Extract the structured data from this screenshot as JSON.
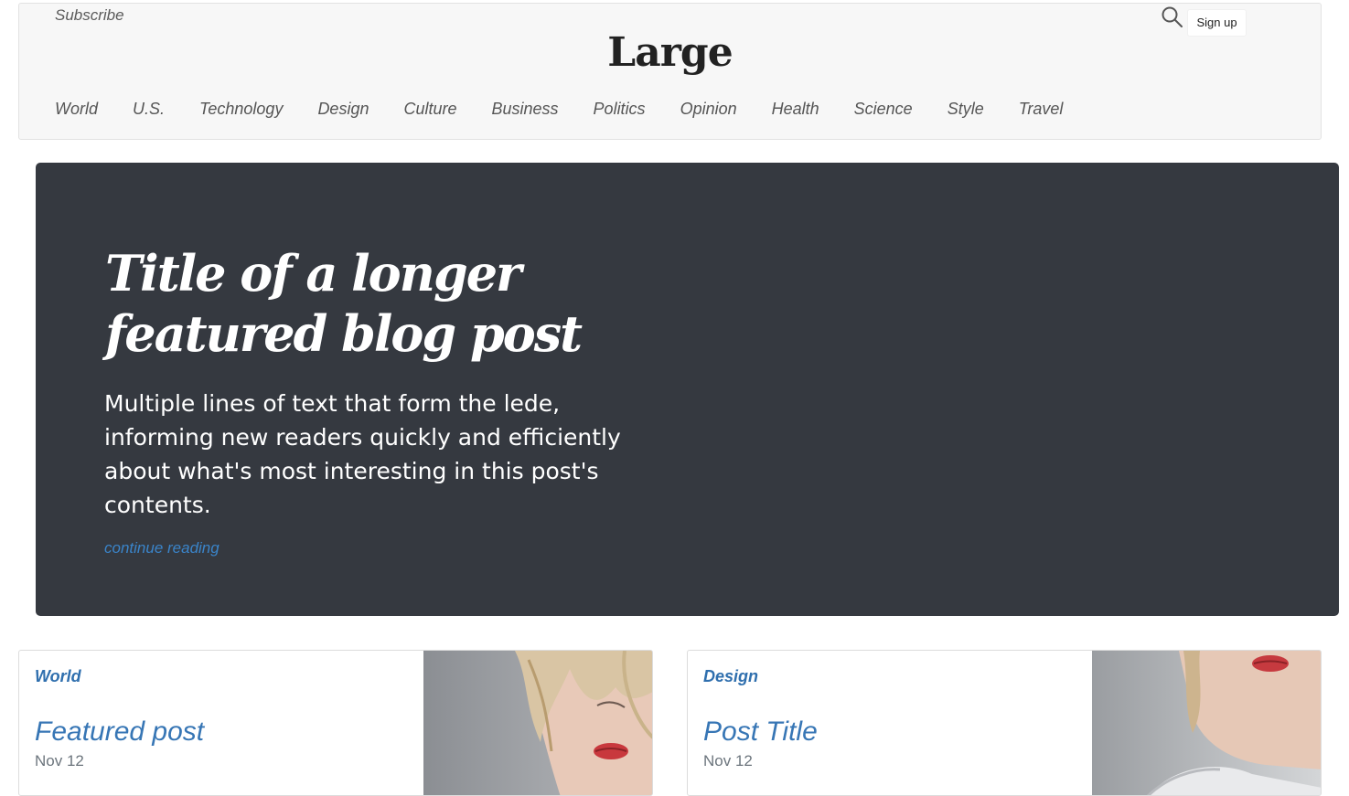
{
  "header": {
    "subscribe_label": "Subscribe",
    "brand": "Large",
    "signup_label": "Sign up",
    "search_icon": "search-icon"
  },
  "nav": {
    "items": [
      "World",
      "U.S.",
      "Technology",
      "Design",
      "Culture",
      "Business",
      "Politics",
      "Opinion",
      "Health",
      "Science",
      "Style",
      "Travel"
    ]
  },
  "hero": {
    "title_line1": "Title of a longer",
    "title_line2": "featured blog post",
    "lede": "Multiple lines of text that form the lede, informing new readers quickly and efficiently about what's most interesting in this post's contents.",
    "link_label": "continue reading"
  },
  "cards": [
    {
      "category": "World",
      "title": "Featured post",
      "date": "Nov 12"
    },
    {
      "category": "Design",
      "title": "Post Title",
      "date": "Nov 12"
    }
  ],
  "colors": {
    "hero_bg": "#353940",
    "accent": "#3776b5",
    "header_bg": "#f7f7f7"
  }
}
